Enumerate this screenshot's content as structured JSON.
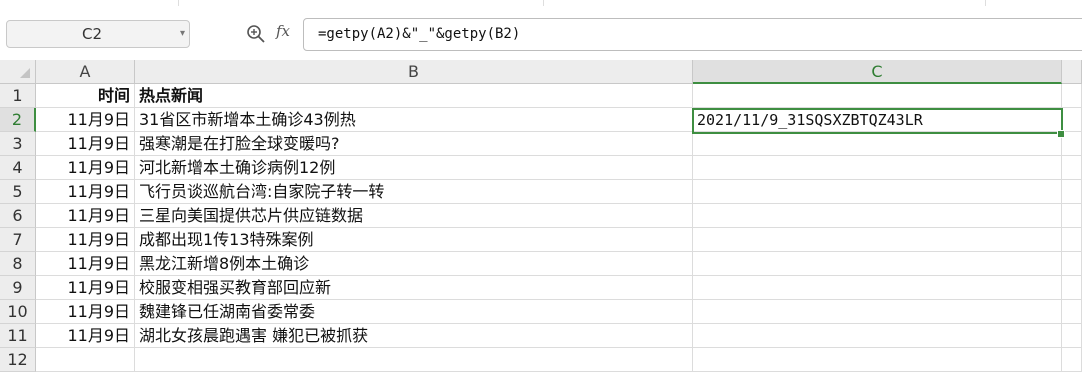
{
  "name_box": {
    "value": "C2"
  },
  "formula_bar": {
    "zoom_icon": "search-zoom-icon",
    "fx_label": "fx",
    "formula": "=getpy(A2)&\"_\"&getpy(B2)"
  },
  "grid": {
    "columns": [
      "A",
      "B",
      "C"
    ],
    "selected_cell": "C2",
    "accent_color": "#3e8e41",
    "rows": [
      {
        "row": "1",
        "a": "时间",
        "b": "热点新闻",
        "c": ""
      },
      {
        "row": "2",
        "a": "11月9日",
        "b": "31省区市新增本土确诊43例热",
        "c": "2021/11/9_31SQSXZBTQZ43LR"
      },
      {
        "row": "3",
        "a": "11月9日",
        "b": "强寒潮是在打脸全球变暖吗?",
        "c": ""
      },
      {
        "row": "4",
        "a": "11月9日",
        "b": "河北新增本土确诊病例12例",
        "c": ""
      },
      {
        "row": "5",
        "a": "11月9日",
        "b": "飞行员谈巡航台湾:自家院子转一转",
        "c": ""
      },
      {
        "row": "6",
        "a": "11月9日",
        "b": "三星向美国提供芯片供应链数据",
        "c": ""
      },
      {
        "row": "7",
        "a": "11月9日",
        "b": "成都出现1传13特殊案例",
        "c": ""
      },
      {
        "row": "8",
        "a": "11月9日",
        "b": "黑龙江新增8例本土确诊",
        "c": ""
      },
      {
        "row": "9",
        "a": "11月9日",
        "b": "校服变相强买教育部回应新",
        "c": ""
      },
      {
        "row": "10",
        "a": "11月9日",
        "b": "魏建锋已任湖南省委常委",
        "c": ""
      },
      {
        "row": "11",
        "a": "11月9日",
        "b": "湖北女孩晨跑遇害 嫌犯已被抓获",
        "c": ""
      },
      {
        "row": "12",
        "a": "",
        "b": "",
        "c": ""
      }
    ]
  }
}
